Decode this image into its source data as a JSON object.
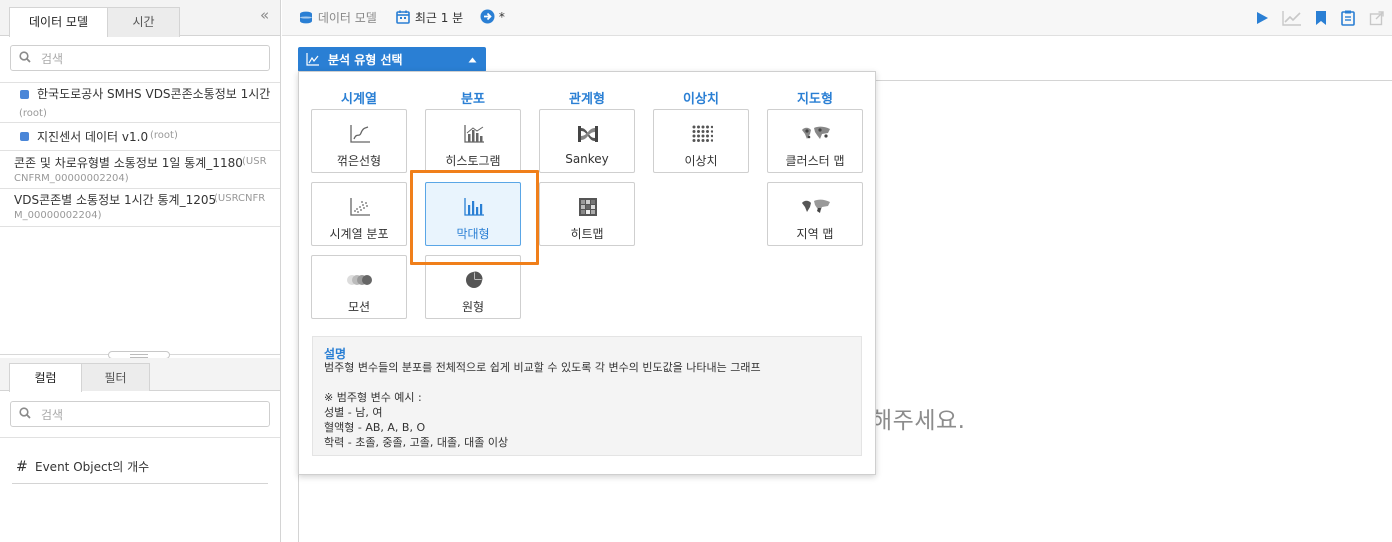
{
  "left_panel": {
    "tabs": [
      "데이터 모델",
      "시간"
    ],
    "search_placeholder": "검색",
    "tree": [
      {
        "label": "한국도로공사 SMHS VDS콘존소통정보 1시간",
        "sub": "(root)"
      },
      {
        "label": "지진센서 데이터 v1.0",
        "sub": "(root)"
      },
      {
        "label": "콘존 및 차로유형별 소통정보 1일 통계_1180",
        "sub_inline": "(USR",
        "sub2": "CNFRM_00000002204)"
      },
      {
        "label": "VDS콘존별 소통정보 1시간 통계_1205",
        "sub_inline": "(USRCNFR",
        "sub2": "M_00000002204)"
      }
    ],
    "bottom_tabs": [
      "컬럼",
      "필터"
    ],
    "bottom_search_placeholder": "검색",
    "columns": [
      {
        "symbol": "#",
        "label": "Event Object의 개수"
      }
    ]
  },
  "topbar": {
    "data_model_label": "데이터 모델",
    "time_label": "최근 1 분",
    "star_label": "*",
    "icons": [
      "play-icon",
      "line-chart-icon",
      "bookmark-icon",
      "report-icon",
      "export-icon"
    ]
  },
  "analysis": {
    "button_label": "분석 유형 선택",
    "categories": [
      "시계열",
      "분포",
      "관계형",
      "이상치",
      "지도형"
    ],
    "cards": {
      "line": "꺾은선형",
      "histogram": "히스토그램",
      "sankey": "Sankey",
      "outlier": "이상치",
      "cluster_map": "클러스터 맵",
      "ts_distribution": "시계열 분포",
      "bar": "막대형",
      "heatmap": "히트맵",
      "region_map": "지역 맵",
      "motion": "모션",
      "pie": "원형"
    },
    "selected": "막대형",
    "description": {
      "title": "설명",
      "lines": [
        "범주형 변수들의 분포를 전체적으로 쉽게 비교할 수 있도록 각 변수의 빈도값을 나타내는 그래프",
        "",
        "※ 범주형 변수 예시 :",
        "성별 - 남, 여",
        "혈액형 - AB, A, B, O",
        "학력 - 초졸, 중졸, 고졸, 대졸, 대졸 이상"
      ]
    }
  },
  "canvas": {
    "message_visible": "해주세요."
  },
  "colors": {
    "accent": "#2a7fd4",
    "highlight": "#f07f1a"
  }
}
